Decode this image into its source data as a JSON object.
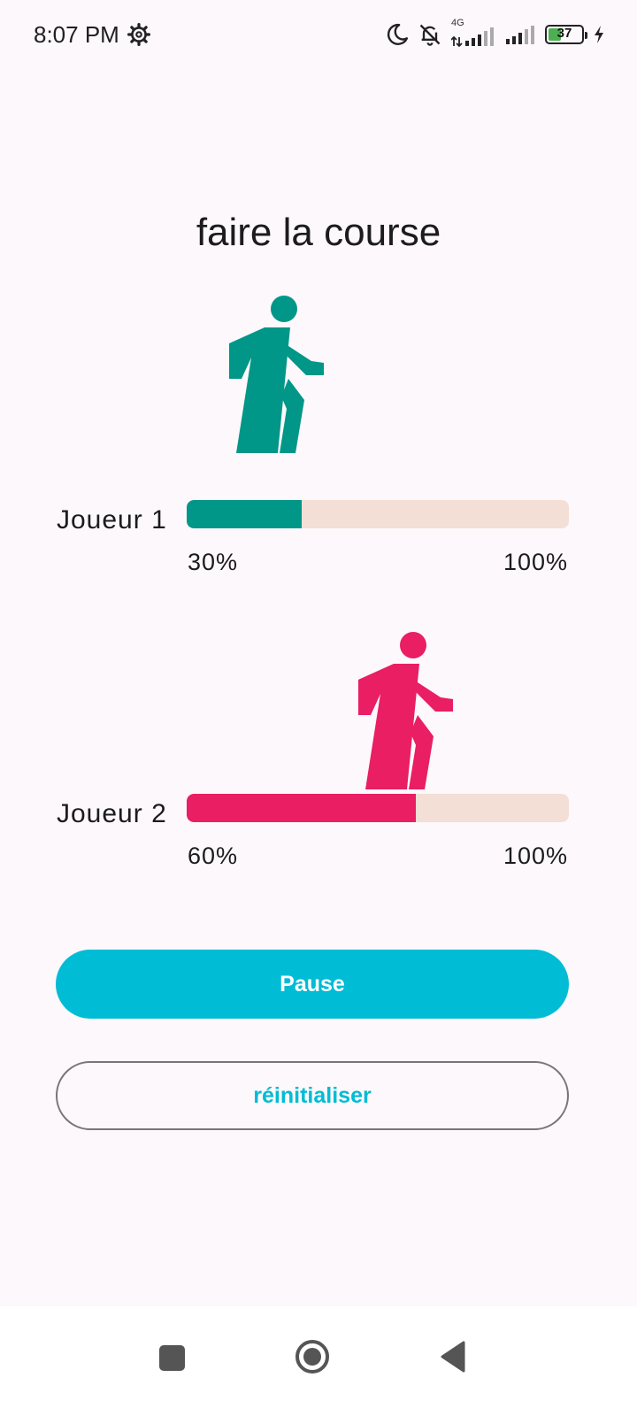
{
  "status_bar": {
    "time": "8:07 PM",
    "network": "4G",
    "battery": "37",
    "icons": [
      "gear-icon",
      "moon-icon",
      "bell-off-icon",
      "signal-icon",
      "signal-icon",
      "battery-icon",
      "charging-icon"
    ]
  },
  "title": "faire la course",
  "players": [
    {
      "label": "Joueur 1",
      "progress_percent": 30,
      "progress_label": "30%",
      "max_label": "100%",
      "color": "#009688",
      "icon": "walking-person-icon"
    },
    {
      "label": "Joueur 2",
      "progress_percent": 60,
      "progress_label": "60%",
      "max_label": "100%",
      "color": "#e91e63",
      "icon": "walking-person-icon"
    }
  ],
  "buttons": {
    "pause_label": "Pause",
    "reset_label": "réinitialiser"
  },
  "nav_bar": {
    "icons": [
      "recents-square-icon",
      "home-circle-icon",
      "back-triangle-icon"
    ]
  },
  "colors": {
    "accent": "#00bcd4",
    "track_background": "#f3dfd6",
    "page_background": "#fdf8fc"
  }
}
